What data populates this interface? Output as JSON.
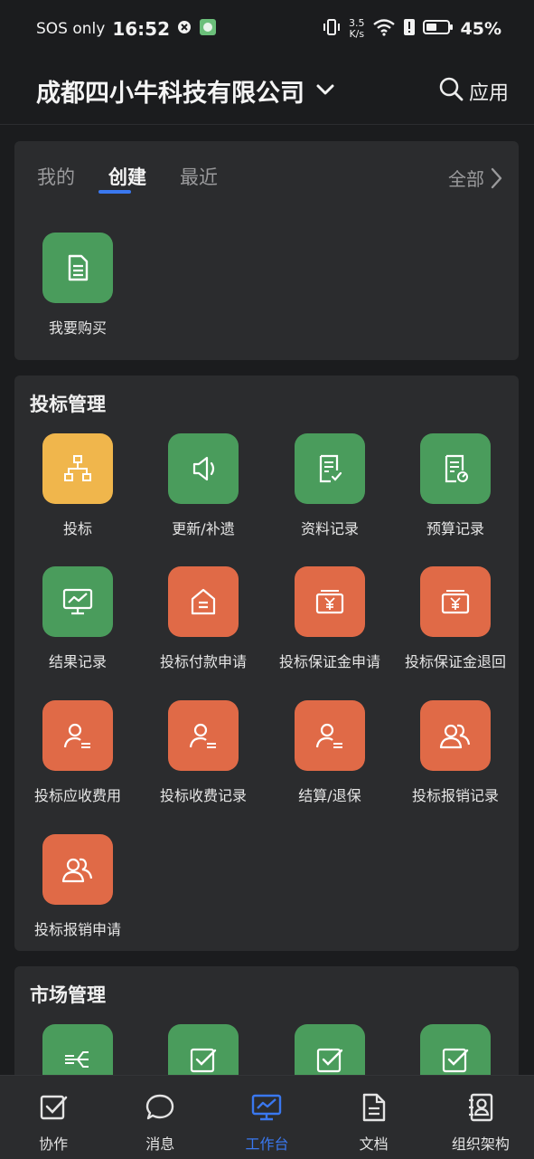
{
  "status_bar": {
    "carrier": "SOS only",
    "time": "16:52",
    "net_speed_value": "3.5",
    "net_speed_unit": "K/s",
    "battery": "45%"
  },
  "header": {
    "company": "成都四小牛科技有限公司",
    "apps_label": "应用"
  },
  "quick": {
    "tabs": [
      "我的",
      "创建",
      "最近"
    ],
    "active_tab": "创建",
    "all_label": "全部",
    "items": [
      {
        "label": "我要购买",
        "icon": "document-icon",
        "color": "#4a9c5c"
      }
    ]
  },
  "bidding": {
    "title": "投标管理",
    "items": [
      {
        "label": "投标",
        "icon": "org-chart-icon"
      },
      {
        "label": "更新/补遗",
        "icon": "speaker-icon"
      },
      {
        "label": "资料记录",
        "icon": "doc-check-icon"
      },
      {
        "label": "预算记录",
        "icon": "doc-gauge-icon"
      },
      {
        "label": "结果记录",
        "icon": "monitor-chart-icon"
      },
      {
        "label": "投标付款申请",
        "icon": "house-icon"
      },
      {
        "label": "投标保证金申请",
        "icon": "yuan-box-icon"
      },
      {
        "label": "投标保证金退回",
        "icon": "yuan-box-icon"
      },
      {
        "label": "投标应收费用",
        "icon": "person-list-icon"
      },
      {
        "label": "投标收费记录",
        "icon": "person-list-icon"
      },
      {
        "label": "结算/退保",
        "icon": "person-list-icon"
      },
      {
        "label": "投标报销记录",
        "icon": "people-icon"
      },
      {
        "label": "投标报销申请",
        "icon": "people-icon"
      }
    ]
  },
  "market": {
    "title": "市场管理",
    "items": [
      {
        "icon": "flow-icon"
      },
      {
        "icon": "checkbox-icon"
      },
      {
        "icon": "checkbox-icon"
      },
      {
        "icon": "checkbox-icon"
      }
    ]
  },
  "nav": {
    "items": [
      "协作",
      "消息",
      "工作台",
      "文档",
      "组织架构"
    ],
    "active": "工作台"
  },
  "colors": {
    "accent": "#3a78f0",
    "green": "#4a9c5c",
    "yellow": "#f0b64c",
    "orange": "#e06a47"
  }
}
